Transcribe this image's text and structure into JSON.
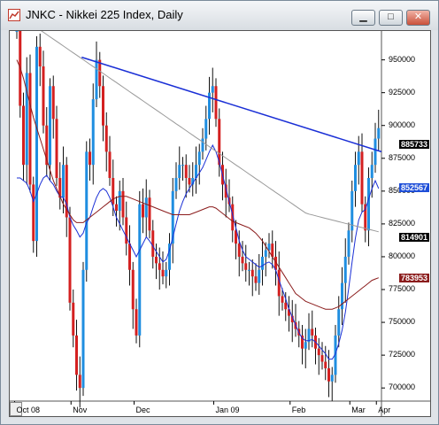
{
  "window": {
    "title": "JNKC - Nikkei 225 Index, Daily",
    "buttons": {
      "minimize": "▁",
      "maximize": "□",
      "close": "✕"
    }
  },
  "chart_data": {
    "type": "candlestick",
    "title": "JNKC - Nikkei 225 Index, Daily",
    "ylim": [
      690,
      972
    ],
    "y_ticks": [
      700,
      725,
      750,
      775,
      800,
      825,
      850,
      875,
      900,
      925,
      950
    ],
    "x_tick_labels": [
      "Oct 08",
      "Nov",
      "Dec",
      "Jan 09",
      "Feb",
      "Mar",
      "Apr"
    ],
    "price_tags": [
      {
        "label": "885733",
        "value": 885.7,
        "color": "#000000"
      },
      {
        "label": "852567",
        "value": 852.6,
        "color": "#1f4fd8"
      },
      {
        "label": "814901",
        "value": 814.9,
        "color": "#000000"
      },
      {
        "label": "783953",
        "value": 784.0,
        "color": "#8b1c1c"
      }
    ],
    "trendline": {
      "start": {
        "date": "Nov",
        "value": 952
      },
      "end": {
        "date": "Apr",
        "value": 880
      },
      "color": "#1a2fd6"
    },
    "series": [
      {
        "name": "",
        "values": [
          972,
          915,
          870,
          940,
          855,
          812,
          960,
          945,
          900,
          870,
          930,
          905,
          860,
          845,
          870,
          830,
          765,
          740,
          710,
          700,
          790,
          880,
          870,
          920,
          950,
          930,
          900,
          880,
          860,
          840,
          835,
          850,
          830,
          810,
          790,
          760,
          740,
          840,
          830,
          845,
          820,
          800,
          795,
          790,
          785,
          790,
          810,
          850,
          860,
          870,
          870,
          860,
          855,
          860,
          870,
          880,
          890,
          905,
          925,
          930,
          905,
          870,
          855,
          845,
          840,
          820,
          810,
          800,
          795,
          790,
          790,
          785,
          780,
          790,
          800,
          805,
          810,
          800,
          790,
          770,
          765,
          760,
          755,
          750,
          745,
          740,
          730,
          735,
          745,
          740,
          730,
          725,
          720,
          715,
          705,
          710,
          740,
          760,
          780,
          800,
          820,
          850,
          870,
          880,
          840,
          820,
          860,
          870,
          890,
          898
        ]
      },
      {
        "name": "",
        "values": [
          860,
          860,
          858,
          856,
          850,
          842,
          848,
          855,
          860,
          862,
          858,
          855,
          850,
          846,
          845,
          840,
          830,
          824,
          820,
          815,
          818,
          826,
          830,
          838,
          845,
          850,
          852,
          850,
          845,
          838,
          830,
          825,
          820,
          815,
          810,
          805,
          800,
          805,
          810,
          815,
          812,
          808,
          804,
          800,
          796,
          798,
          805,
          815,
          825,
          835,
          842,
          848,
          852,
          856,
          860,
          864,
          868,
          874,
          880,
          885,
          880,
          872,
          862,
          852,
          842,
          832,
          822,
          812,
          805,
          800,
          798,
          796,
          794,
          792,
          793,
          795,
          796,
          794,
          790,
          782,
          775,
          768,
          760,
          754,
          748,
          742,
          738,
          736,
          736,
          737,
          735,
          732,
          729,
          726,
          722,
          722,
          726,
          734,
          744,
          758,
          776,
          796,
          814,
          828,
          834,
          836,
          844,
          852,
          858,
          852
        ]
      },
      {
        "name": "",
        "values": [
          950,
          944,
          936,
          926,
          916,
          906,
          898,
          890,
          882,
          874,
          866,
          858,
          852,
          846,
          840,
          836,
          832,
          828,
          826,
          826,
          826,
          828,
          830,
          832,
          834,
          836,
          838,
          840,
          842,
          844,
          845,
          846,
          846,
          846,
          845,
          844,
          843,
          842,
          841,
          840,
          839,
          838,
          837,
          836,
          835,
          834,
          833,
          832,
          832,
          832,
          832,
          832,
          832,
          833,
          834,
          835,
          836,
          837,
          838,
          838,
          837,
          835,
          833,
          831,
          829,
          827,
          826,
          825,
          824,
          823,
          822,
          820,
          818,
          815,
          812,
          808,
          804,
          800,
          796,
          792,
          788,
          784,
          780,
          776,
          772,
          770,
          768,
          766,
          765,
          764,
          763,
          762,
          761,
          760,
          760,
          760,
          761,
          762,
          764,
          766,
          768,
          770,
          772,
          774,
          776,
          778,
          780,
          782,
          783,
          784
        ]
      },
      {
        "name": "",
        "values": [
          null,
          null,
          null,
          null,
          null,
          null,
          null,
          null,
          null,
          null,
          null,
          null,
          null,
          null,
          null,
          null,
          null,
          null,
          null,
          null,
          null,
          null,
          null,
          null,
          null,
          null,
          null,
          null,
          null,
          null,
          null,
          null,
          null,
          null,
          null,
          null,
          null,
          null,
          null,
          null,
          null,
          null,
          null,
          null,
          null,
          null,
          null,
          null,
          null,
          null,
          null,
          null,
          null,
          null,
          null,
          null,
          null,
          null,
          null,
          null,
          null,
          null,
          null,
          null,
          null,
          null,
          null,
          null,
          null,
          null,
          null,
          null,
          null,
          null,
          null,
          null,
          null,
          null,
          null,
          null,
          null,
          null,
          null,
          null,
          null,
          null,
          null,
          null,
          null,
          null,
          null,
          null,
          null,
          null,
          null,
          null,
          null,
          null,
          null,
          null,
          null,
          null,
          null,
          null,
          null,
          null,
          null,
          null,
          null,
          null
        ]
      }
    ],
    "x": []
  }
}
